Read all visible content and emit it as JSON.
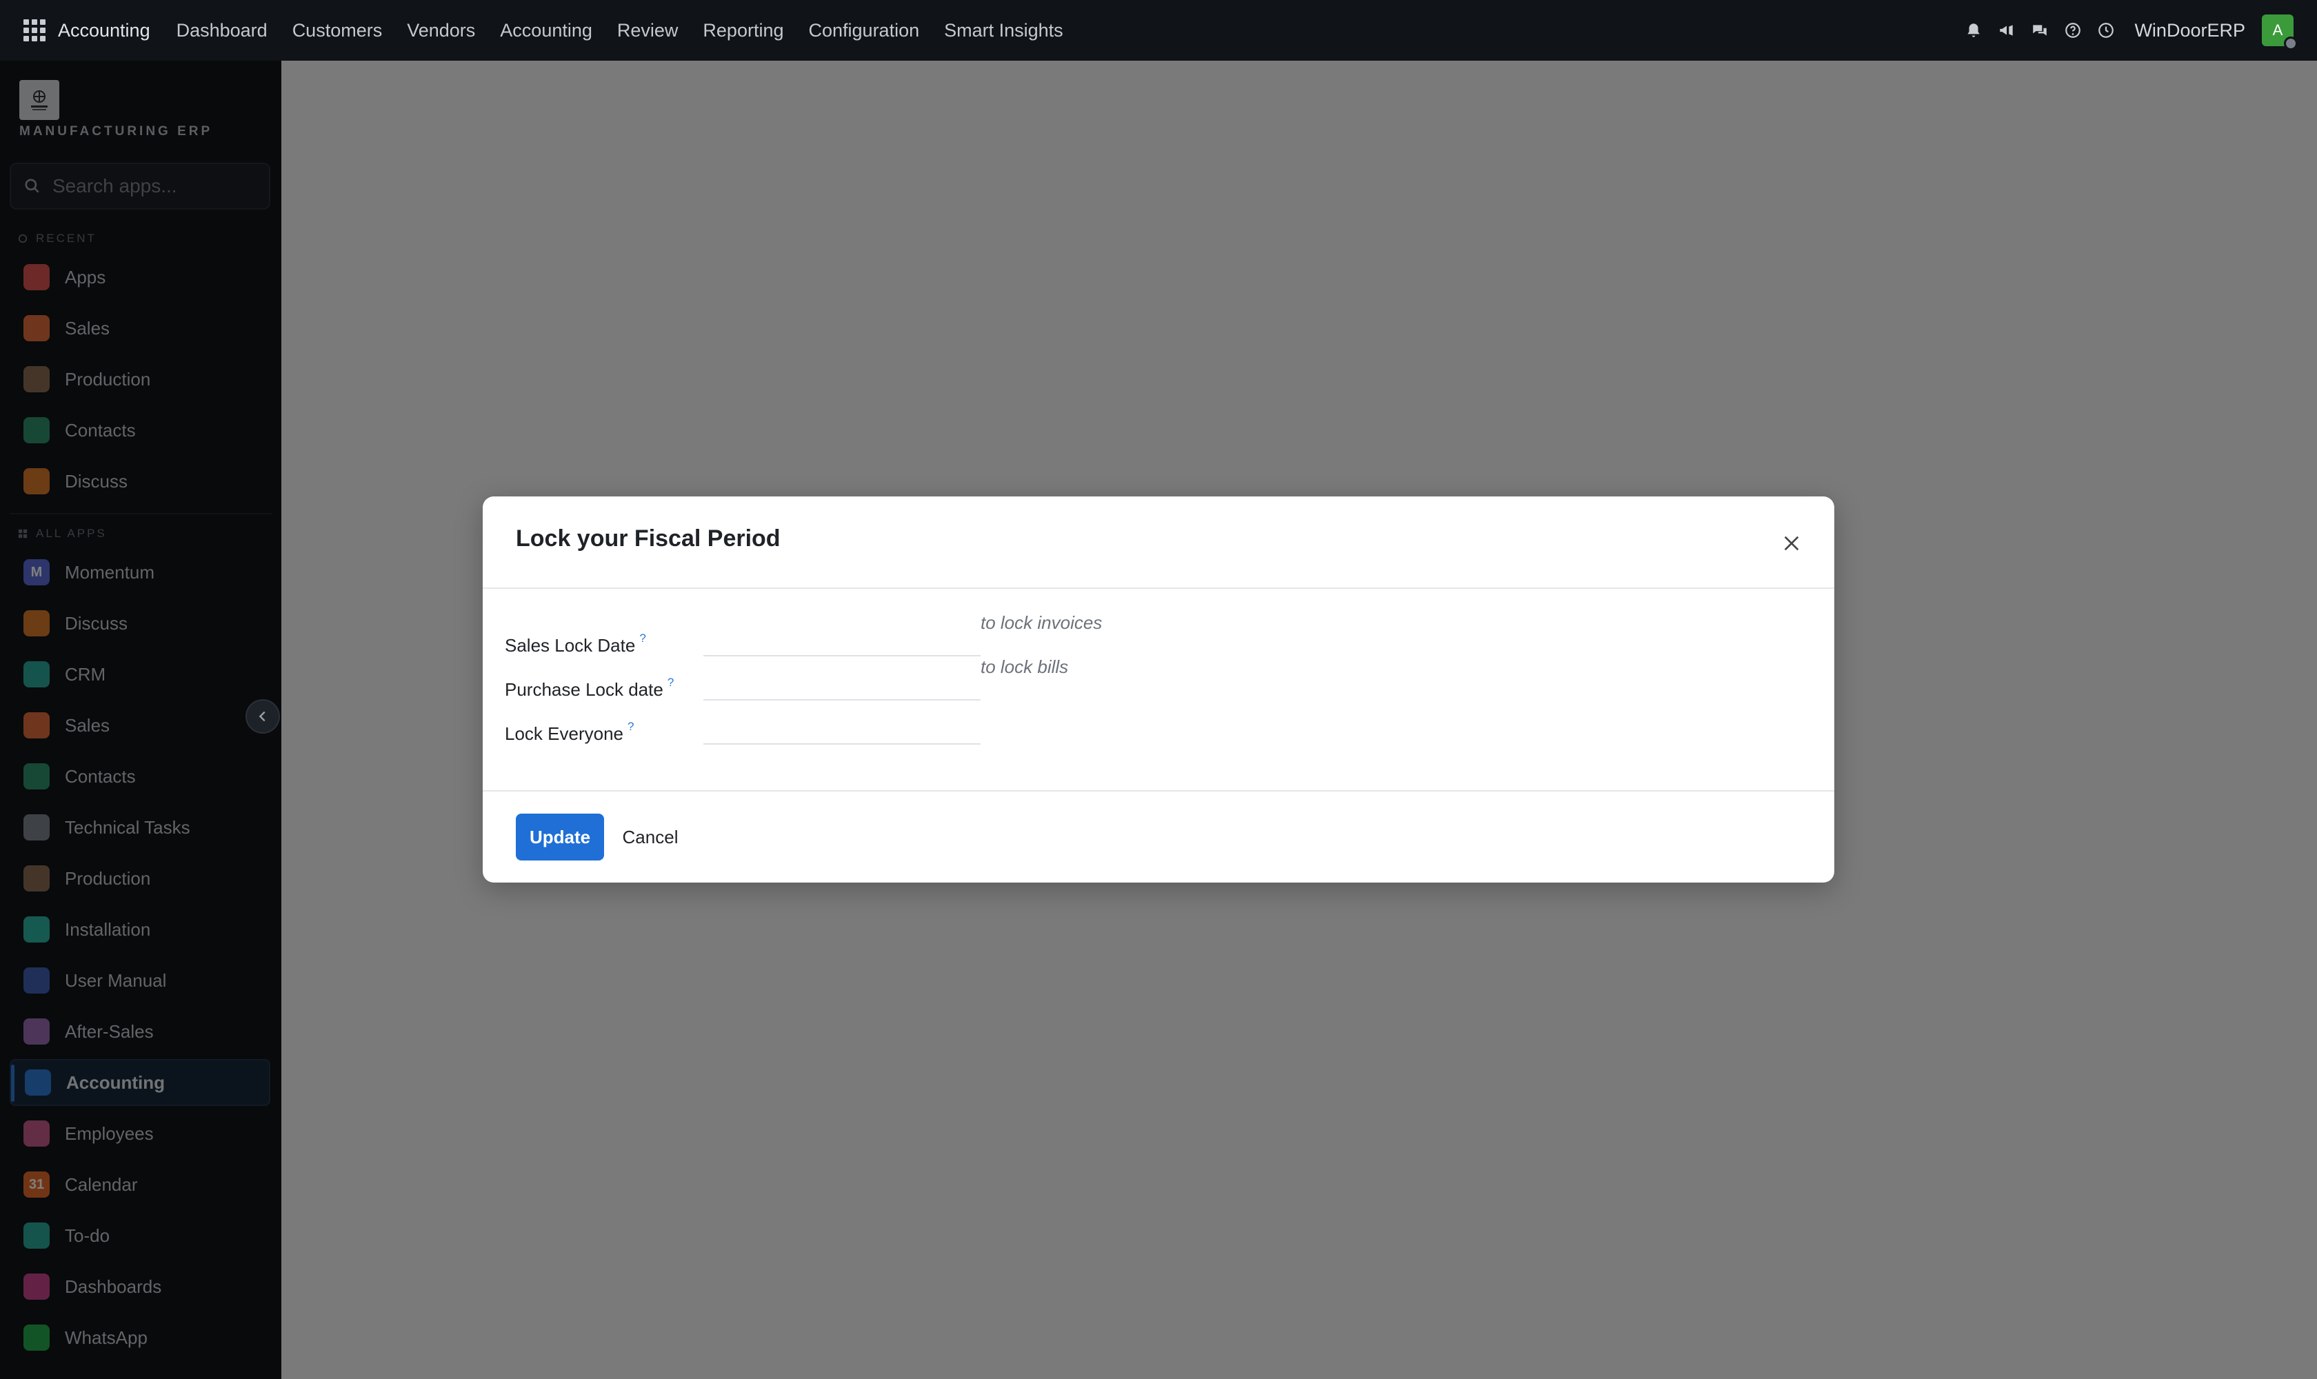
{
  "topbar": {
    "app_name": "Accounting",
    "menu": [
      "Dashboard",
      "Customers",
      "Vendors",
      "Accounting",
      "Review",
      "Reporting",
      "Configuration",
      "Smart Insights"
    ],
    "company": "WinDoorERP",
    "avatar_initial": "A"
  },
  "sidebar": {
    "logo_text": "MANUFACTURING ERP",
    "search_placeholder": "Search apps...",
    "recent_label": "RECENT",
    "all_apps_label": "ALL APPS",
    "recent": [
      {
        "label": "Apps",
        "color": "#d9534f"
      },
      {
        "label": "Sales",
        "color": "#e06b3a"
      },
      {
        "label": "Production",
        "color": "#8a6a52"
      },
      {
        "label": "Contacts",
        "color": "#2f8f6b"
      },
      {
        "label": "Discuss",
        "color": "#d9792b"
      }
    ],
    "all_apps": [
      {
        "label": "Momentum",
        "color": "#5b6bd6",
        "glyph": "M"
      },
      {
        "label": "Discuss",
        "color": "#d9792b",
        "glyph": ""
      },
      {
        "label": "CRM",
        "color": "#2aa79b",
        "glyph": ""
      },
      {
        "label": "Sales",
        "color": "#e06b3a",
        "glyph": ""
      },
      {
        "label": "Contacts",
        "color": "#2f8f6b",
        "glyph": ""
      },
      {
        "label": "Technical Tasks",
        "color": "#7d838c",
        "glyph": ""
      },
      {
        "label": "Production",
        "color": "#8a6a52",
        "glyph": ""
      },
      {
        "label": "Installation",
        "color": "#2bb3a0",
        "glyph": ""
      },
      {
        "label": "User Manual",
        "color": "#3f5fb0",
        "glyph": ""
      },
      {
        "label": "After-Sales",
        "color": "#9a6ab5",
        "glyph": ""
      },
      {
        "label": "Accounting",
        "color": "#2e7ad6",
        "glyph": ""
      },
      {
        "label": "Employees",
        "color": "#c45a8a",
        "glyph": ""
      },
      {
        "label": "Calendar",
        "color": "#e36a2a",
        "glyph": "31"
      },
      {
        "label": "To-do",
        "color": "#2aa79b",
        "glyph": ""
      },
      {
        "label": "Dashboards",
        "color": "#c6458a",
        "glyph": ""
      },
      {
        "label": "WhatsApp",
        "color": "#25a84a",
        "glyph": ""
      }
    ],
    "active": "Accounting"
  },
  "dialog": {
    "title": "Lock your Fiscal Period",
    "fields": [
      {
        "label": "Sales Lock Date",
        "help": "?",
        "value": "",
        "hint": "to lock invoices"
      },
      {
        "label": "Purchase Lock date",
        "help": "?",
        "value": "",
        "hint": "to lock bills"
      },
      {
        "label": "Lock Everyone",
        "help": "?",
        "value": "",
        "hint": ""
      }
    ],
    "update_label": "Update",
    "cancel_label": "Cancel"
  }
}
